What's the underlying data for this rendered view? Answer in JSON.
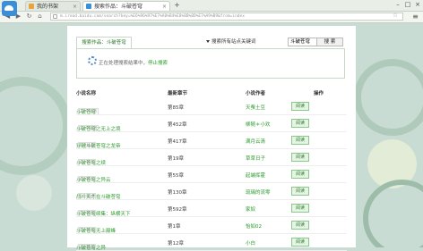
{
  "browser": {
    "tabs": [
      {
        "title": "我的书架",
        "active": false
      },
      {
        "title": "搜索作品：斗破苍穹",
        "active": true
      }
    ],
    "address": "m.iread.baidu.com/search?key=%E6%96%97%E7%A0%B4%E8%8B%8D%E7%A9%B9&from=index",
    "window_controls": [
      "–",
      "□",
      "×"
    ]
  },
  "search": {
    "tab_label": "搜索作品：斗破苍穹",
    "scope_label": "搜索所有站点关键词",
    "keyword": "斗破苍穹",
    "button": "搜 索",
    "loading_text": "正在处理搜索结果中，",
    "loading_link": "停止搜索"
  },
  "table": {
    "headers": [
      "小说名称",
      "最新章节",
      "小说作者",
      "操作"
    ],
    "rows": [
      {
        "name": "斗破苍穹",
        "tag": "37个站点",
        "chapter": "第85章",
        "author": "天蚕土豆",
        "action": "阅读"
      },
      {
        "name": "斗破苍穹之无上之境",
        "tag": "11个站点",
        "chapter": "第452章",
        "author": "柳随＊小欢",
        "action": "阅读"
      },
      {
        "name": "穿越斗破苍穹之龙帝",
        "tag": "7个站点",
        "chapter": "第417章",
        "author": "满月云清",
        "action": "阅读"
      },
      {
        "name": "斗破苍穹之续",
        "tag": "8个站点",
        "chapter": "第19章",
        "author": "草草日子",
        "action": "阅读"
      },
      {
        "name": "斗破苍穹之异云",
        "tag": "6个站点",
        "chapter": "第55章",
        "author": "起端挥霍",
        "action": "阅读"
      },
      {
        "name": "战斗天才在斗破苍穹",
        "tag": "6个站点",
        "chapter": "第130章",
        "author": "琉璃的流零",
        "action": "阅读"
      },
      {
        "name": "斗破苍穹续集：纵横天下",
        "tag": "5个站点",
        "chapter": "第592章",
        "author": "家奴",
        "action": "阅读"
      },
      {
        "name": "斗破苍穹无上巅峰",
        "tag": "5个站点",
        "chapter": "第1章",
        "author": "怡如02",
        "action": "阅读"
      },
      {
        "name": "斗破苍穹之异",
        "tag": "4个站点",
        "chapter": "第12章",
        "author": "小白",
        "action": "阅读"
      }
    ]
  },
  "colors": {
    "accent": "#2a9a2a",
    "background": "#c9dcd3"
  }
}
